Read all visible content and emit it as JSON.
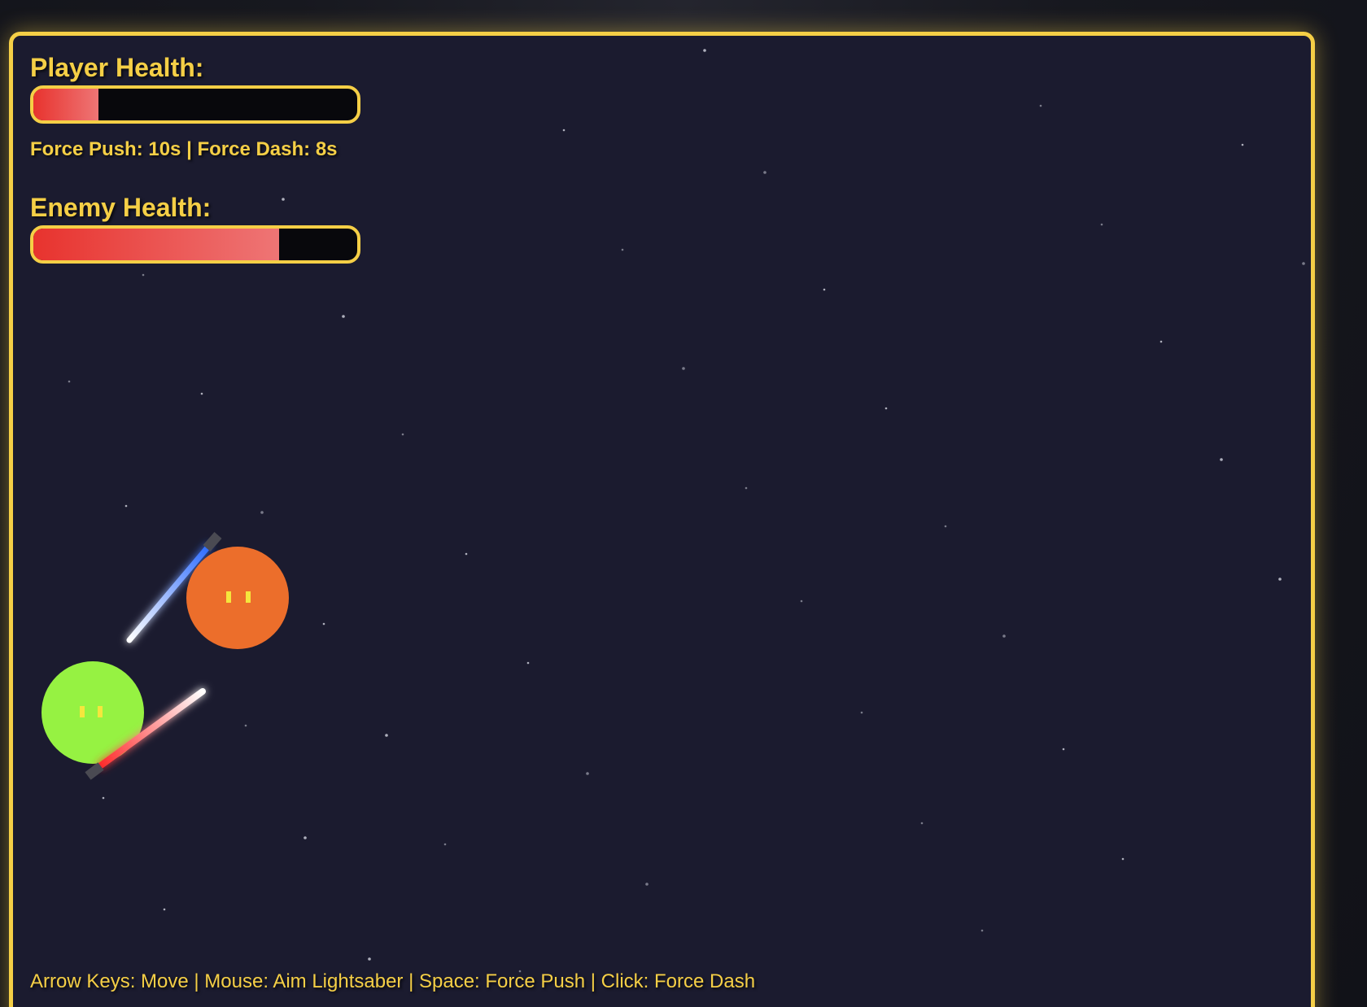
{
  "hud": {
    "player_health_label": "Player Health:",
    "player_health_fraction": 0.2,
    "cooldowns_text": "Force Push: 10s | Force Dash: 8s",
    "enemy_health_label": "Enemy Health:",
    "enemy_health_fraction": 0.76
  },
  "controls_text": "Arrow Keys: Move | Mouse: Aim Lightsaber | Space: Force Push | Click: Force Dash",
  "colors": {
    "frame_border": "#f5cf46",
    "arena_background": "#1b1b2f",
    "health_fill_start": "#e8332e",
    "health_fill_end": "#ee7575",
    "player_body": "#96f242",
    "player_saber": "#e83a3a",
    "enemy_body": "#ec6e2b",
    "enemy_saber": "#3b78ff",
    "eyes": "#f5e63d"
  },
  "characters": [
    {
      "role": "player",
      "body_color": "green",
      "saber_color": "red"
    },
    {
      "role": "enemy",
      "body_color": "orange",
      "saber_color": "blue"
    }
  ]
}
